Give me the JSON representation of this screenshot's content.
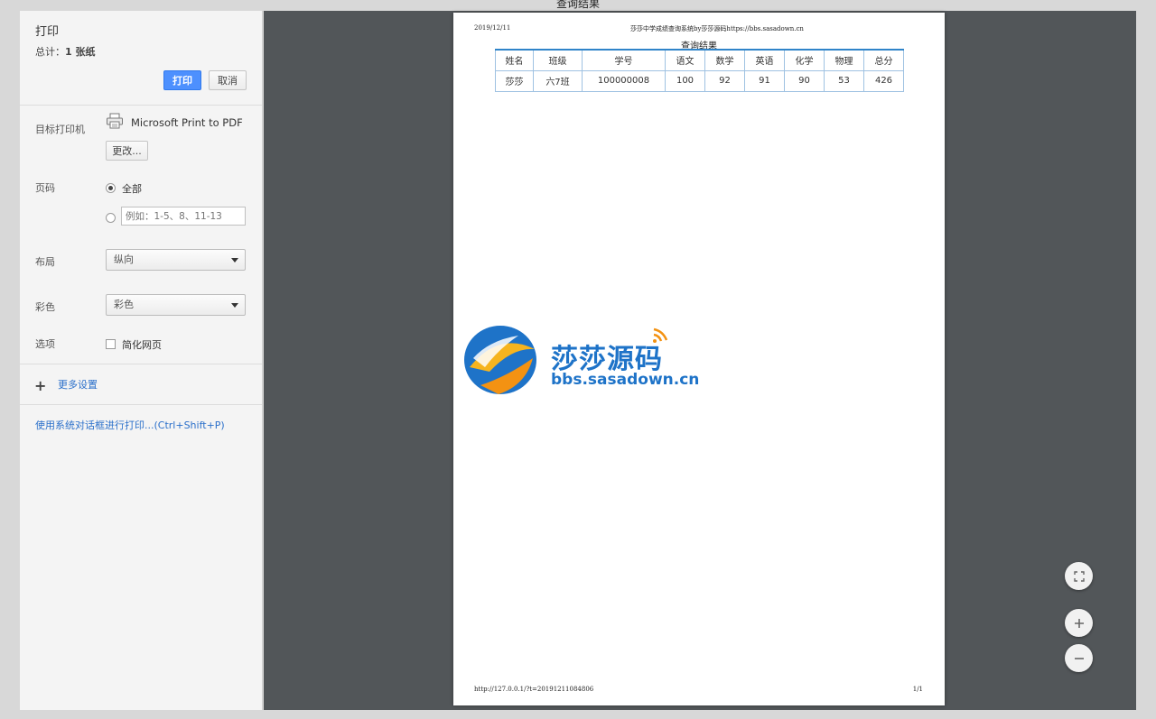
{
  "window": {
    "title": "查询结果"
  },
  "sidebar": {
    "title": "打印",
    "total_prefix": "总计：",
    "total_value": "1 张纸",
    "print_button": "打印",
    "cancel_button": "取消",
    "destination_label": "目标打印机",
    "printer_name": "Microsoft Print to PDF",
    "change_button": "更改...",
    "pages_label": "页码",
    "pages_all": "全部",
    "pages_custom_placeholder": "例如：1-5、8、11-13",
    "layout_label": "布局",
    "layout_value": "纵向",
    "color_label": "彩色",
    "color_value": "彩色",
    "options_label": "选项",
    "simplify_label": "简化网页",
    "more_settings": "更多设置",
    "system_dialog_link": "使用系统对话框进行打印...(Ctrl+Shift+P)"
  },
  "preview": {
    "header_date": "2019/12/11",
    "header_title": "莎莎中学成绩查询系统by莎莎源码https://bbs.sasadown.cn",
    "table_caption": "查询结果",
    "table": {
      "columns": [
        "姓名",
        "班级",
        "学号",
        "语文",
        "数学",
        "英语",
        "化学",
        "物理",
        "总分"
      ],
      "rows": [
        [
          "莎莎",
          "六7班",
          "100000008",
          "100",
          "92",
          "91",
          "90",
          "53",
          "426"
        ]
      ]
    },
    "watermark_name": "莎莎源码",
    "watermark_url": "bbs.sasadown.cn",
    "footer_url": "http://127.0.0.1/?t=20191211084806",
    "footer_page": "1/1"
  },
  "icons": {
    "printer": "printer-icon",
    "plus": "plus-icon",
    "fit": "fit-to-page-icon",
    "zoom_in": "zoom-in-icon",
    "zoom_out": "zoom-out-icon"
  },
  "colors": {
    "primary_button": "#4d90fe",
    "link": "#2a6fca",
    "preview_bg": "#525659",
    "table_border": "#2f84c9"
  }
}
